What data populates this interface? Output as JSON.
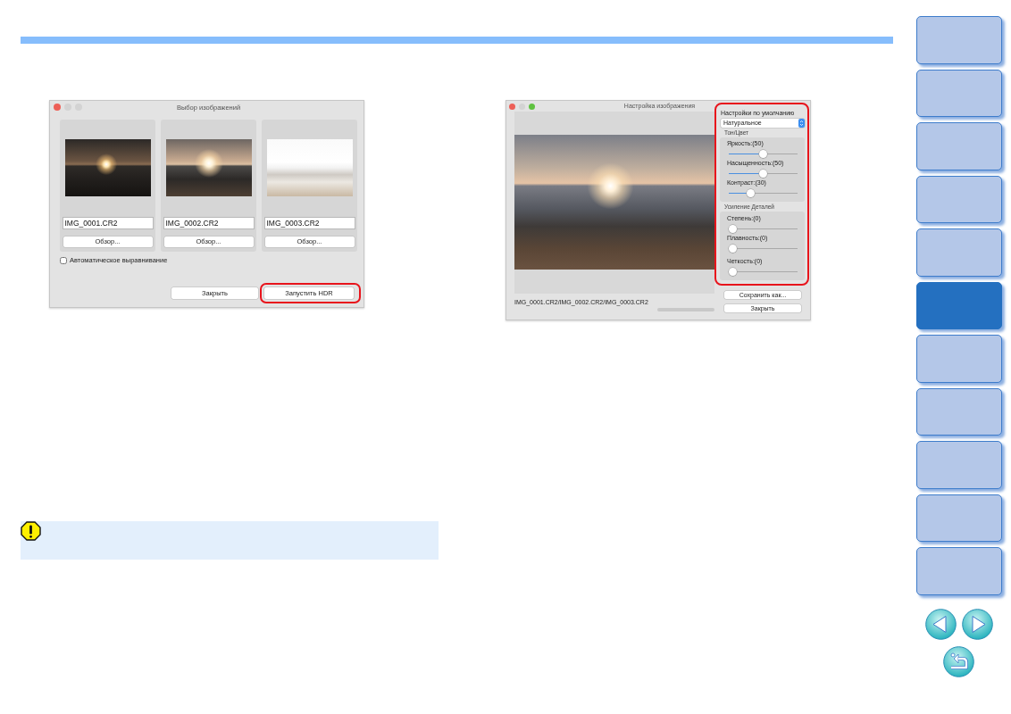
{
  "image_selection_dialog": {
    "title": "Выбор изображений",
    "window_controls": [
      {
        "color": "#ed5f57"
      },
      {
        "color": "#d3d3d3"
      },
      {
        "color": "#d3d3d3"
      }
    ],
    "images": [
      {
        "file_name": "IMG_0001.CR2",
        "browse_button": "Обзор..."
      },
      {
        "file_name": "IMG_0002.CR2",
        "browse_button": "Обзор..."
      },
      {
        "file_name": "IMG_0003.CR2",
        "browse_button": "Обзор..."
      }
    ],
    "auto_align": {
      "label": "Автоматическое выравнивание",
      "checked": false
    },
    "buttons": [
      {
        "label": "Закрыть",
        "highlighted": false
      },
      {
        "label": "Запустить HDR",
        "highlighted": true
      }
    ]
  },
  "image_adjustment_dialog": {
    "title": "Настройка изображения",
    "window_controls": [
      {
        "color": "#ed5f57"
      },
      {
        "color": "#d3d3d3"
      },
      {
        "color": "#5fc240"
      }
    ],
    "file_names": "IMG_0001.CR2/IMG_0002.CR2/IMG_0003.CR2",
    "settings_panel": {
      "highlighted": true,
      "title": "Настройки по умолчанию",
      "preset": "Натуральное",
      "groups": [
        {
          "title": "Тон/Цвет",
          "sliders": [
            {
              "label": "Яркость:(50)",
              "level": 0.5
            },
            {
              "label": "Насыщенность:(50)",
              "level": 0.5
            },
            {
              "label": "Контраст:(30)",
              "level": 0.3
            }
          ]
        },
        {
          "title": "Усиление Деталей",
          "sliders": [
            {
              "label": "Степень:(0)",
              "level": 0
            },
            {
              "label": "Плавность:(0)",
              "level": 0
            },
            {
              "label": "Четкость:(0)",
              "level": 0
            }
          ]
        }
      ]
    },
    "buttons": [
      {
        "label": "Сохранить как..."
      },
      {
        "label": "Закрыть"
      }
    ]
  },
  "sidebar": {
    "tabs": [
      {
        "selected": false
      },
      {
        "selected": false
      },
      {
        "selected": false
      },
      {
        "selected": false
      },
      {
        "selected": false
      },
      {
        "selected": true
      },
      {
        "selected": false
      },
      {
        "selected": false
      },
      {
        "selected": false
      },
      {
        "selected": false
      },
      {
        "selected": false
      }
    ]
  }
}
